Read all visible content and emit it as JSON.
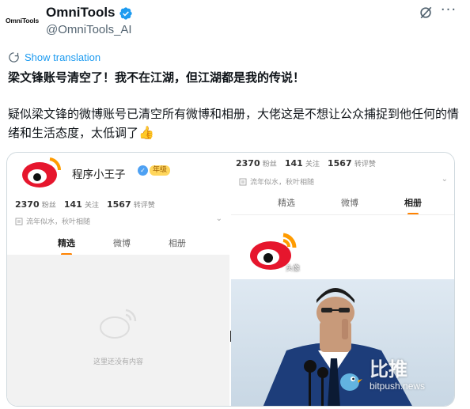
{
  "header": {
    "avatar_text": "OmniTools",
    "name": "OmniTools",
    "handle": "@OmniTools_AI",
    "more_label": "···"
  },
  "translate": {
    "label": "Show translation"
  },
  "tweet": {
    "line1": "梁文锋账号清空了！我不在江湖，但江湖都是我的传说！",
    "line2": "疑似梁文锋的微博账号已清空所有微博和相册，大佬这是不想让公众捕捉到他任何的情绪和生活态度，太低调了",
    "emoji": "👍"
  },
  "left_panel": {
    "name": "程序小王子",
    "badge_year": "年级",
    "stats": [
      {
        "value": "2370",
        "label": "粉丝"
      },
      {
        "value": "141",
        "label": "关注"
      },
      {
        "value": "1567",
        "label": "转评赞"
      }
    ],
    "bio": "流年似水，秋叶相随",
    "tabs": [
      {
        "label": "精选",
        "active": true
      },
      {
        "label": "微博",
        "active": false
      },
      {
        "label": "相册",
        "active": false
      }
    ],
    "empty_text": "这里还没有内容"
  },
  "right_panel": {
    "stats": [
      {
        "value": "2370",
        "label": "粉丝"
      },
      {
        "value": "141",
        "label": "关注"
      },
      {
        "value": "1567",
        "label": "转评赞"
      }
    ],
    "bio": "流年似水，秋叶相随",
    "tabs": [
      {
        "label": "精选",
        "active": false
      },
      {
        "label": "微博",
        "active": false
      },
      {
        "label": "相册",
        "active": true
      }
    ],
    "album_label": "头像",
    "watermark_cn": "比推",
    "watermark_en": "bitpush.news"
  },
  "colors": {
    "accent": "#1d9bf0",
    "weibo_red": "#e6162d",
    "weibo_orange": "#ff8200"
  }
}
